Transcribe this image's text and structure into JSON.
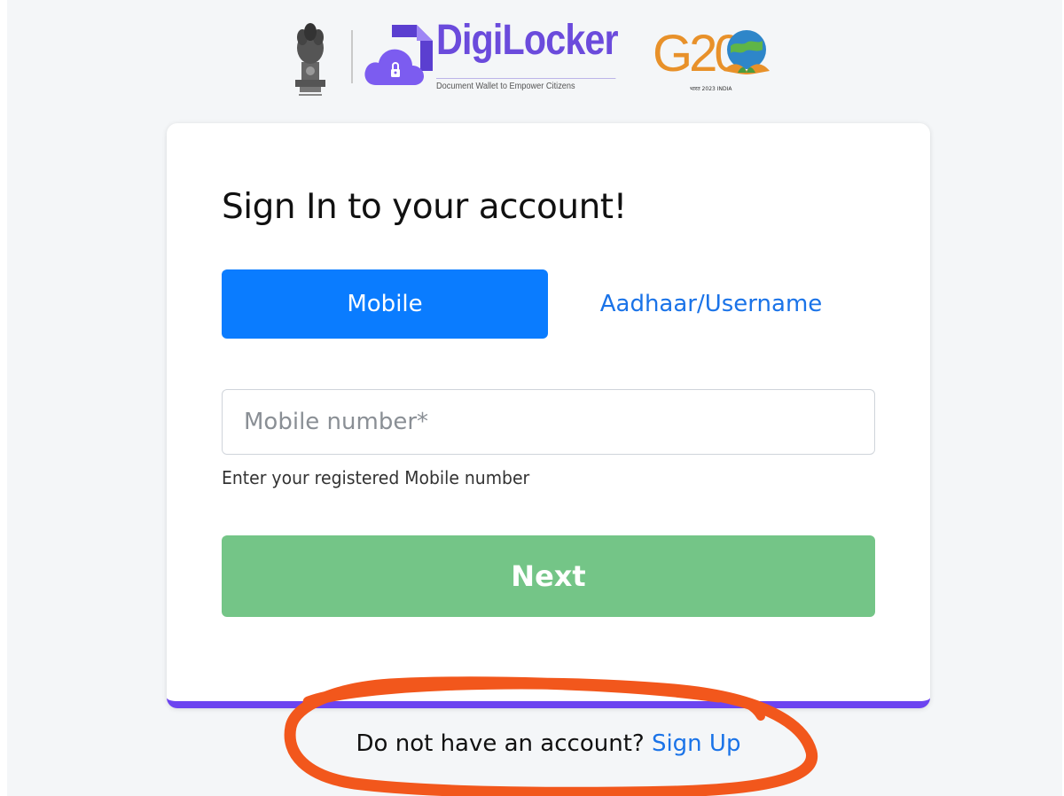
{
  "header": {
    "brand_name": "DigiLocker",
    "brand_tagline": "Document Wallet to Empower Citizens",
    "g20_letters": "G20",
    "g20_subtext": "भारत 2023 INDIA"
  },
  "signin": {
    "title": "Sign In to your account!",
    "tabs": [
      {
        "label": "Mobile",
        "active": true
      },
      {
        "label": "Aadhaar/Username",
        "active": false
      }
    ],
    "mobile_field": {
      "placeholder": "Mobile number*",
      "value": "",
      "helper": "Enter your registered Mobile number"
    },
    "next_label": "Next"
  },
  "footer": {
    "prompt": "Do not have an account?",
    "signup_label": "Sign Up"
  },
  "colors": {
    "primary_blue": "#0a7cff",
    "link_blue": "#1a73e8",
    "next_green": "#74c587",
    "brand_purple": "#6b4bdc",
    "card_accent": "#6c44f0",
    "annotation_orange": "#f2571c"
  }
}
